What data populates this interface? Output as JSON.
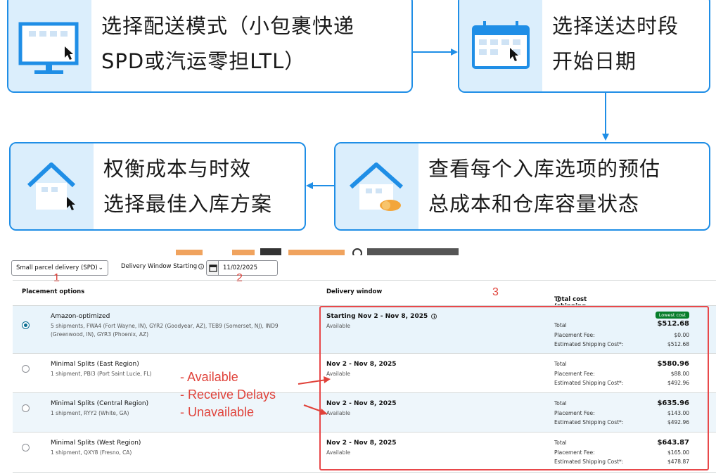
{
  "flow": {
    "step1": {
      "line1": "选择配送模式（小包裹快递",
      "line2": "SPD或汽运零担LTL）"
    },
    "step2": {
      "line1": "选择送达时段",
      "line2": "开始日期"
    },
    "step3": {
      "line1": "查看每个入库选项的预估",
      "line2": "总成本和仓库容量状态"
    },
    "step4": {
      "line1": "权衡成本与时效",
      "line2": "选择最佳入库方案"
    }
  },
  "colors": {
    "accent": "#1f8ee6",
    "icon_bg": "#dbeefc",
    "annotation": "#e0423a",
    "badge": "#067d2a"
  },
  "controls": {
    "mode_select": "Small parcel delivery (SPD)",
    "delivery_window_label": "Delivery Window Starting",
    "date_value": "11/02/2025"
  },
  "annotations": {
    "n1": "1",
    "n2": "2",
    "n3": "3",
    "list": [
      "- Available",
      "- Receive Delays",
      "- Unavailable"
    ]
  },
  "table": {
    "headers": {
      "placement": "Placement options",
      "window": "Delivery window",
      "cost": "Total cost (shipping estimated)"
    },
    "cost_labels": {
      "total": "Total",
      "placement_fee": "Placement Fee:",
      "shipping": "Estimated Shipping Cost*:"
    },
    "badge": "Lowest cost",
    "rows": [
      {
        "name": "Amazon-optimized",
        "desc": "5 shipments, FWA4 (Fort Wayne, IN), GYR2 (Goodyear, AZ), TEB9 (Somerset, NJ), IND9 (Greenwood, IN), GYR3 (Phoenix, AZ)",
        "window": "Starting Nov 2 - Nov 8, 2025",
        "status": "Available",
        "total": "$512.68",
        "fee": "$0.00",
        "shipping": "$512.68",
        "selected": true
      },
      {
        "name": "Minimal Splits  (East Region)",
        "desc": "1 shipment, PBI3 (Port Saint Lucie, FL)",
        "window": "Nov 2 - Nov 8, 2025",
        "status": "Available",
        "total": "$580.96",
        "fee": "$88.00",
        "shipping": "$492.96",
        "selected": false
      },
      {
        "name": "Minimal Splits  (Central Region)",
        "desc": "1 shipment, RYY2 (White, GA)",
        "window": "Nov 2 - Nov 8, 2025",
        "status": "Available",
        "total": "$635.96",
        "fee": "$143.00",
        "shipping": "$492.96",
        "selected": false
      },
      {
        "name": "Minimal Splits  (West Region)",
        "desc": "1 shipment, QXY8 (Fresno, CA)",
        "window": "Nov 2 - Nov 8, 2025",
        "status": "Available",
        "total": "$643.87",
        "fee": "$165.00",
        "shipping": "$478.87",
        "selected": false
      }
    ]
  }
}
